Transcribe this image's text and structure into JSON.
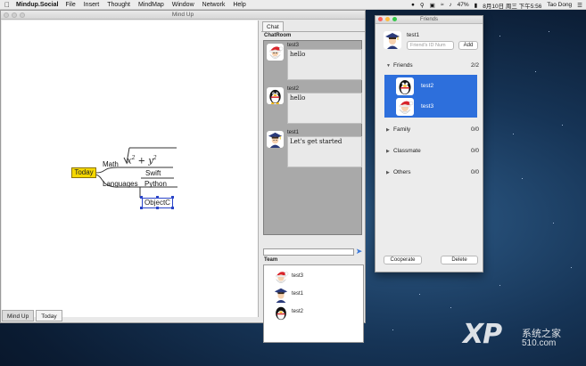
{
  "menubar": {
    "app_name": "Mindup.Social",
    "items": [
      "File",
      "Insert",
      "Thought",
      "MindMap",
      "Window",
      "Network",
      "Help"
    ],
    "status": {
      "battery": "47%",
      "datetime": "8月10日 周三 下午5:56",
      "user": "Tao Dong"
    }
  },
  "main_window": {
    "title": "Mind Up",
    "mindmap": {
      "root": "Today",
      "nodes": {
        "math": "Math",
        "languages": "Languages",
        "swift": "Swift",
        "python": "Python",
        "objectc": "ObjectC"
      },
      "formula": {
        "x": "x",
        "y": "y",
        "exp": "2",
        "plus": "+"
      }
    },
    "bottom_tabs": [
      "Mind Up",
      "Today"
    ],
    "chat": {
      "tab": "Chat",
      "chatroom_label": "ChatRoom",
      "messages": [
        {
          "user": "test3",
          "text": "hello",
          "avatar": "santa-avatar"
        },
        {
          "user": "test2",
          "text": "hello",
          "avatar": "penguin-avatar"
        },
        {
          "user": "test1",
          "text": "Let's get started",
          "avatar": "graduate-avatar"
        }
      ],
      "team_label": "Team",
      "team": [
        {
          "name": "test3",
          "avatar": "santa-avatar"
        },
        {
          "name": "test1",
          "avatar": "graduate-avatar"
        },
        {
          "name": "test2",
          "avatar": "penguin-avatar"
        }
      ]
    }
  },
  "friends_window": {
    "title": "Friends",
    "self_name": "test1",
    "input_placeholder": "Friend's ID Num",
    "add_label": "Add",
    "groups": [
      {
        "name": "Friends",
        "count": "2/2",
        "expanded": true
      },
      {
        "name": "Family",
        "count": "0/0",
        "expanded": false
      },
      {
        "name": "Classmate",
        "count": "0/0",
        "expanded": false
      },
      {
        "name": "Others",
        "count": "0/0",
        "expanded": false
      }
    ],
    "friends": [
      {
        "name": "test2",
        "avatar": "penguin-avatar"
      },
      {
        "name": "test3",
        "avatar": "santa-avatar"
      }
    ],
    "cooperate_label": "Cooperate",
    "delete_label": "Delete"
  },
  "watermark": {
    "logo": "XP",
    "site_cn": "系统之家",
    "site_num": "510.com"
  },
  "colors": {
    "root_node": "#f5d800",
    "selection": "#2a44c8",
    "friends_highlight": "#2d6fdc"
  }
}
